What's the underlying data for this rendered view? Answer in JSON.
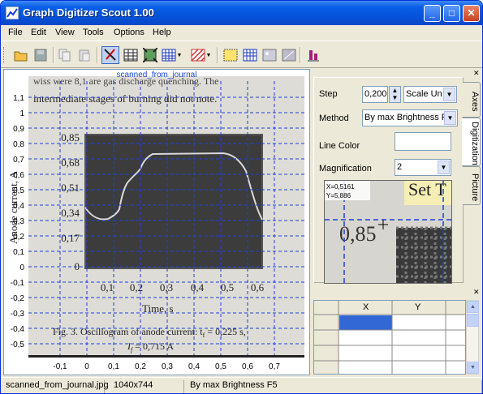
{
  "window": {
    "title": "Graph Digitizer Scout 1.00"
  },
  "menu": [
    "File",
    "Edit",
    "View",
    "Tools",
    "Options",
    "Help"
  ],
  "plot": {
    "label": "scanned_from_journal",
    "x_ticks": [
      "-0,1",
      "0",
      "0,1",
      "0,2",
      "0,3",
      "0,4",
      "0,5",
      "0,6",
      "0,7"
    ],
    "y_ticks": [
      "1,1",
      "1",
      "0,9",
      "0,8",
      "0,7",
      "0,6",
      "0,5",
      "0,4",
      "0,3",
      "0,2",
      "0,1",
      "0",
      "-0,1",
      "-0,2",
      "-0,3",
      "-0,4",
      "-0,5"
    ]
  },
  "scan": {
    "line1": "wiss were 8,1 are gas discharge quenching. The",
    "line2": "intermediate stages of burning did not note.",
    "y_axis_label": "Anode current, A",
    "y_ticks": [
      "0,85",
      "0,68",
      "0,51",
      "0,34",
      "0,17",
      "0"
    ],
    "x_ticks": [
      "0,1",
      "0,2",
      "0,3",
      "0,4",
      "0,5",
      "0,6"
    ],
    "x_axis_label": "Time, s",
    "caption1": "Fig. 3. Oscillogram of anode current: t",
    "caption1_sub": "f",
    "caption1_end": " = 0,225 s,",
    "caption2": "I",
    "caption2_sub": "f",
    "caption2_end": " = 0,715 A"
  },
  "digitization": {
    "step_label": "Step",
    "step_value": "0,200",
    "scale_units": "Scale Un",
    "method_label": "Method",
    "method_value": "By max Brightness  F",
    "line_color_label": "Line Color",
    "magnification_label": "Magnification",
    "magnification_value": "2",
    "magnifier": {
      "x_readout": "X=0,5161",
      "y_readout": "Y=5,886",
      "text_corner": "Set T",
      "text_value": "0,85"
    }
  },
  "tabs": [
    "Axes",
    "Digitization",
    "Picture"
  ],
  "table": {
    "columns": [
      "X",
      "Y"
    ],
    "rows": 4
  },
  "status": {
    "file": "scanned_from_journal.jpg",
    "size": "1040x744",
    "method": "By max Brightness  F5"
  },
  "colors": {
    "grid": "#1f3fd8",
    "title_blue": "#1a4ad6",
    "xp_blue": "#0553dc",
    "selection": "#3168d5"
  }
}
